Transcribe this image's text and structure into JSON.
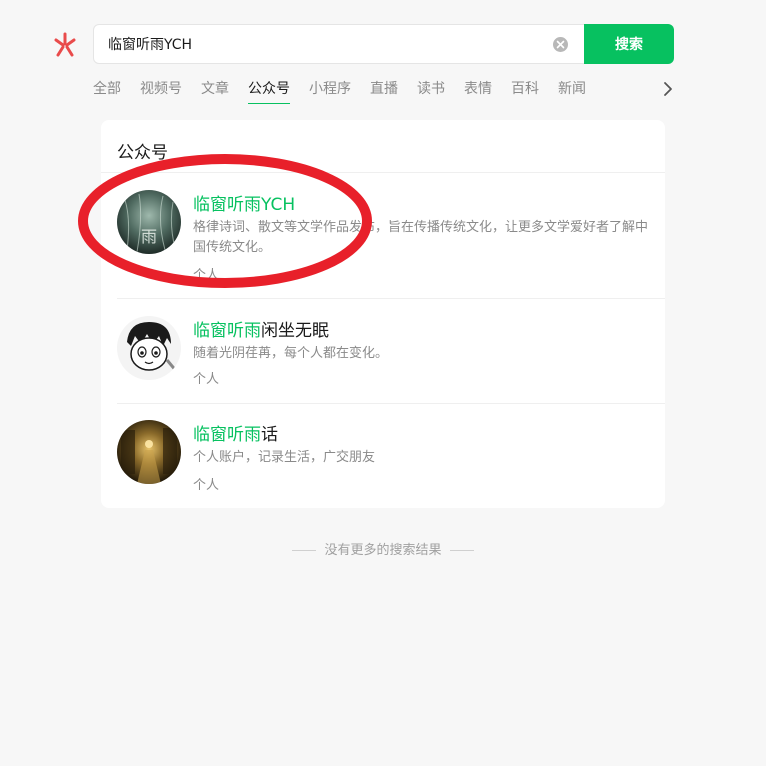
{
  "search": {
    "query": "临窗听雨YCH",
    "button_label": "搜索"
  },
  "tabs": [
    {
      "label": "全部",
      "active": false
    },
    {
      "label": "视频号",
      "active": false
    },
    {
      "label": "文章",
      "active": false
    },
    {
      "label": "公众号",
      "active": true
    },
    {
      "label": "小程序",
      "active": false
    },
    {
      "label": "直播",
      "active": false
    },
    {
      "label": "读书",
      "active": false
    },
    {
      "label": "表情",
      "active": false
    },
    {
      "label": "百科",
      "active": false
    },
    {
      "label": "新闻",
      "active": false
    }
  ],
  "section": {
    "title": "公众号"
  },
  "results": [
    {
      "title_highlight": "临窗听雨YCH",
      "title_rest": "",
      "description": "格律诗词、散文等文学作品发布，旨在传播传统文化，让更多文学爱好者了解中国传统文化。",
      "tag": "个人"
    },
    {
      "title_highlight": "临窗听雨",
      "title_rest": "闲坐无眠",
      "description": "随着光阴荏苒，每个人都在变化。",
      "tag": "个人"
    },
    {
      "title_highlight": "临窗听雨",
      "title_rest": "话",
      "description": "个人账户，记录生活，广交朋友",
      "tag": "个人"
    }
  ],
  "footer": {
    "text": "没有更多的搜索结果"
  },
  "avatar_glyph": "雨",
  "colors": {
    "accent": "#07c160",
    "annotation": "#e8202a",
    "logo": "#e94b4b"
  }
}
